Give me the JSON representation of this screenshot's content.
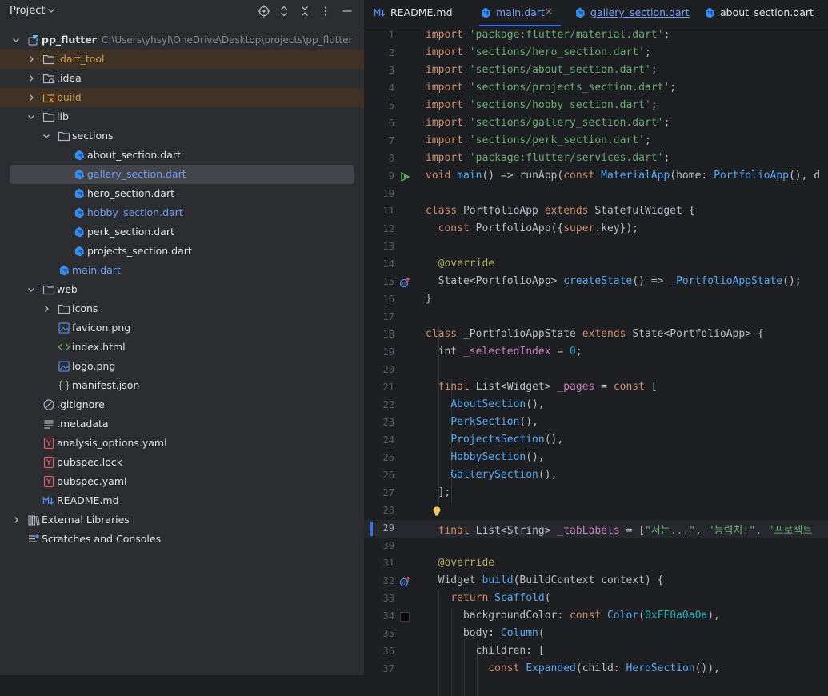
{
  "project": {
    "title": "Project",
    "tree": [
      {
        "label": "pp_flutter",
        "path": "C:\\Users\\yhsyl\\OneDrive\\Desktop\\projects\\pp_flutter",
        "depth": 0,
        "icon": "flutter-module-icon",
        "expanded": true
      },
      {
        "label": ".dart_tool",
        "depth": 1,
        "icon": "folder-icon",
        "expanded": false,
        "ignored": true
      },
      {
        "label": ".idea",
        "depth": 1,
        "icon": "folder-settings-icon",
        "expanded": false
      },
      {
        "label": "build",
        "depth": 1,
        "icon": "folder-excluded-icon",
        "expanded": false,
        "ignored": true
      },
      {
        "label": "lib",
        "depth": 1,
        "icon": "folder-icon",
        "expanded": true
      },
      {
        "label": "sections",
        "depth": 2,
        "icon": "folder-icon",
        "expanded": true
      },
      {
        "label": "about_section.dart",
        "depth": 3,
        "icon": "dart-file-icon"
      },
      {
        "label": "gallery_section.dart",
        "depth": 3,
        "icon": "dart-file-icon",
        "selected": true,
        "modified": true
      },
      {
        "label": "hero_section.dart",
        "depth": 3,
        "icon": "dart-file-icon"
      },
      {
        "label": "hobby_section.dart",
        "depth": 3,
        "icon": "dart-file-icon",
        "modified": true
      },
      {
        "label": "perk_section.dart",
        "depth": 3,
        "icon": "dart-file-icon"
      },
      {
        "label": "projects_section.dart",
        "depth": 3,
        "icon": "dart-file-icon"
      },
      {
        "label": "main.dart",
        "depth": 2,
        "icon": "dart-file-icon",
        "modified": true
      },
      {
        "label": "web",
        "depth": 1,
        "icon": "folder-icon",
        "expanded": true
      },
      {
        "label": "icons",
        "depth": 2,
        "icon": "folder-icon",
        "expanded": false
      },
      {
        "label": "favicon.png",
        "depth": 2,
        "icon": "image-file-icon"
      },
      {
        "label": "index.html",
        "depth": 2,
        "icon": "html-file-icon"
      },
      {
        "label": "logo.png",
        "depth": 2,
        "icon": "image-file-icon"
      },
      {
        "label": "manifest.json",
        "depth": 2,
        "icon": "json-file-icon"
      },
      {
        "label": ".gitignore",
        "depth": 1,
        "icon": "ignore-file-icon"
      },
      {
        "label": ".metadata",
        "depth": 1,
        "icon": "text-file-icon"
      },
      {
        "label": "analysis_options.yaml",
        "depth": 1,
        "icon": "yaml-file-icon"
      },
      {
        "label": "pubspec.lock",
        "depth": 1,
        "icon": "yaml-file-icon"
      },
      {
        "label": "pubspec.yaml",
        "depth": 1,
        "icon": "yaml-file-icon"
      },
      {
        "label": "README.md",
        "depth": 1,
        "icon": "markdown-file-icon"
      },
      {
        "label": "External Libraries",
        "depth": 0,
        "icon": "libraries-icon",
        "expanded": false
      },
      {
        "label": "Scratches and Consoles",
        "depth": 0,
        "icon": "scratches-icon"
      }
    ]
  },
  "tabs": [
    {
      "label": "README.md",
      "icon": "markdown-file-icon"
    },
    {
      "label": "main.dart",
      "icon": "dart-file-icon",
      "active": true,
      "close": "×"
    },
    {
      "label": "gallery_section.dart",
      "icon": "dart-file-icon",
      "modified": true
    },
    {
      "label": "about_section.dart",
      "icon": "dart-file-icon"
    }
  ],
  "editor": {
    "current_line": 29,
    "lines": [
      {
        "n": "1",
        "t": [
          [
            "kw",
            "import "
          ],
          [
            "str",
            "'package:flutter/material.dart'"
          ],
          [
            "",
            "; "
          ]
        ]
      },
      {
        "n": "2",
        "t": [
          [
            "kw",
            "import "
          ],
          [
            "str",
            "'sections/hero_section.dart'"
          ],
          [
            "",
            ";"
          ]
        ]
      },
      {
        "n": "3",
        "t": [
          [
            "kw",
            "import "
          ],
          [
            "str",
            "'sections/about_section.dart'"
          ],
          [
            "",
            ";"
          ]
        ]
      },
      {
        "n": "4",
        "t": [
          [
            "kw",
            "import "
          ],
          [
            "str",
            "'sections/projects_section.dart'"
          ],
          [
            "",
            ";"
          ]
        ]
      },
      {
        "n": "5",
        "t": [
          [
            "kw",
            "import "
          ],
          [
            "str",
            "'sections/hobby_section.dart'"
          ],
          [
            "",
            ";"
          ]
        ]
      },
      {
        "n": "6",
        "t": [
          [
            "kw",
            "import "
          ],
          [
            "str",
            "'sections/gallery_section.dart'"
          ],
          [
            "",
            ";"
          ]
        ]
      },
      {
        "n": "7",
        "t": [
          [
            "kw",
            "import "
          ],
          [
            "str",
            "'sections/perk_section.dart'"
          ],
          [
            "",
            ";"
          ]
        ]
      },
      {
        "n": "8",
        "t": [
          [
            "kw",
            "import "
          ],
          [
            "str",
            "'package:flutter/services.dart'"
          ],
          [
            "",
            ";"
          ]
        ]
      },
      {
        "n": "9",
        "gutter": "run-icon",
        "t": [
          [
            "kw",
            "void "
          ],
          [
            "fn",
            "main"
          ],
          [
            "",
            "() => runApp("
          ],
          [
            "kw",
            "const "
          ],
          [
            "cls",
            "MaterialApp"
          ],
          [
            "",
            "(home: "
          ],
          [
            "cls",
            "PortfolioApp"
          ],
          [
            "",
            "(), d"
          ]
        ]
      },
      {
        "n": "10",
        "t": []
      },
      {
        "n": "11",
        "t": [
          [
            "kw",
            "class "
          ],
          [
            "",
            "PortfolioApp "
          ],
          [
            "kw",
            "extends "
          ],
          [
            "",
            "StatefulWidget {"
          ]
        ]
      },
      {
        "n": "12",
        "t": [
          [
            "",
            "  "
          ],
          [
            "kw",
            "const "
          ],
          [
            "",
            "PortfolioApp({"
          ],
          [
            "kw",
            "super"
          ],
          [
            "",
            ".key});"
          ]
        ]
      },
      {
        "n": "13",
        "t": []
      },
      {
        "n": "14",
        "t": [
          [
            "",
            "  "
          ],
          [
            "ann",
            "@override"
          ]
        ]
      },
      {
        "n": "15",
        "gutter": "override-icon",
        "t": [
          [
            "",
            "  State<PortfolioApp> "
          ],
          [
            "fn",
            "createState"
          ],
          [
            "",
            "() => "
          ],
          [
            "cls",
            "_PortfolioAppState"
          ],
          [
            "",
            "();"
          ]
        ]
      },
      {
        "n": "16",
        "t": [
          [
            "",
            "}"
          ]
        ]
      },
      {
        "n": "17",
        "t": []
      },
      {
        "n": "18",
        "t": [
          [
            "kw",
            "class "
          ],
          [
            "",
            "_PortfolioAppState "
          ],
          [
            "kw",
            "extends "
          ],
          [
            "",
            "State<PortfolioApp> {"
          ]
        ]
      },
      {
        "n": "19",
        "t": [
          [
            "",
            "  int "
          ],
          [
            "fld",
            "_selectedIndex"
          ],
          [
            "",
            " = "
          ],
          [
            "num",
            "0"
          ],
          [
            "",
            ";"
          ]
        ]
      },
      {
        "n": "20",
        "t": []
      },
      {
        "n": "21",
        "t": [
          [
            "",
            "  "
          ],
          [
            "kw",
            "final "
          ],
          [
            "",
            "List<Widget> "
          ],
          [
            "fld",
            "_pages"
          ],
          [
            "",
            " = "
          ],
          [
            "kw",
            "const "
          ],
          [
            "",
            "["
          ]
        ]
      },
      {
        "n": "22",
        "t": [
          [
            "",
            "    "
          ],
          [
            "cls",
            "AboutSection"
          ],
          [
            "",
            "(),"
          ]
        ]
      },
      {
        "n": "23",
        "t": [
          [
            "",
            "    "
          ],
          [
            "cls",
            "PerkSection"
          ],
          [
            "",
            "(),"
          ]
        ]
      },
      {
        "n": "24",
        "t": [
          [
            "",
            "    "
          ],
          [
            "cls",
            "ProjectsSection"
          ],
          [
            "",
            "(),"
          ]
        ]
      },
      {
        "n": "25",
        "t": [
          [
            "",
            "    "
          ],
          [
            "cls",
            "HobbySection"
          ],
          [
            "",
            "(),"
          ]
        ]
      },
      {
        "n": "26",
        "t": [
          [
            "",
            "    "
          ],
          [
            "cls",
            "GallerySection"
          ],
          [
            "",
            "(),"
          ]
        ]
      },
      {
        "n": "27",
        "t": [
          [
            "",
            "  ];"
          ]
        ]
      },
      {
        "n": "28",
        "gutter": "bulb-icon",
        "t": []
      },
      {
        "n": "29",
        "t": [
          [
            "",
            "  "
          ],
          [
            "kw",
            "final "
          ],
          [
            "",
            "List<String> "
          ],
          [
            "fld",
            "_tabLabels"
          ],
          [
            "",
            " = ["
          ],
          [
            "str",
            "\"저는...\""
          ],
          [
            "",
            ", "
          ],
          [
            "str",
            "\"능력치!\""
          ],
          [
            "",
            ", "
          ],
          [
            "str",
            "\"프로젝트"
          ]
        ]
      },
      {
        "n": "30",
        "t": []
      },
      {
        "n": "31",
        "t": [
          [
            "",
            "  "
          ],
          [
            "ann",
            "@override"
          ]
        ]
      },
      {
        "n": "32",
        "gutter": "override-icon",
        "t": [
          [
            "",
            "  Widget "
          ],
          [
            "fn",
            "build"
          ],
          [
            "",
            "(BuildContext context) {"
          ]
        ]
      },
      {
        "n": "33",
        "t": [
          [
            "",
            "    "
          ],
          [
            "kw",
            "return "
          ],
          [
            "cls",
            "Scaffold"
          ],
          [
            "",
            "("
          ]
        ]
      },
      {
        "n": "34",
        "gutter": "color-swatch",
        "t": [
          [
            "",
            "      backgroundColor: "
          ],
          [
            "kw",
            "const "
          ],
          [
            "cls",
            "Color"
          ],
          [
            "",
            "("
          ],
          [
            "num",
            "0xFF0a0a0a"
          ],
          [
            "",
            "),"
          ]
        ]
      },
      {
        "n": "35",
        "t": [
          [
            "",
            "      body: "
          ],
          [
            "cls",
            "Column"
          ],
          [
            "",
            "("
          ]
        ]
      },
      {
        "n": "36",
        "t": [
          [
            "",
            "        children: ["
          ]
        ]
      },
      {
        "n": "37",
        "t": [
          [
            "",
            "          "
          ],
          [
            "kw",
            "const "
          ],
          [
            "cls",
            "Expanded"
          ],
          [
            "",
            "(child: "
          ],
          [
            "cls",
            "HeroSection"
          ],
          [
            "",
            "()),"
          ]
        ]
      }
    ]
  }
}
